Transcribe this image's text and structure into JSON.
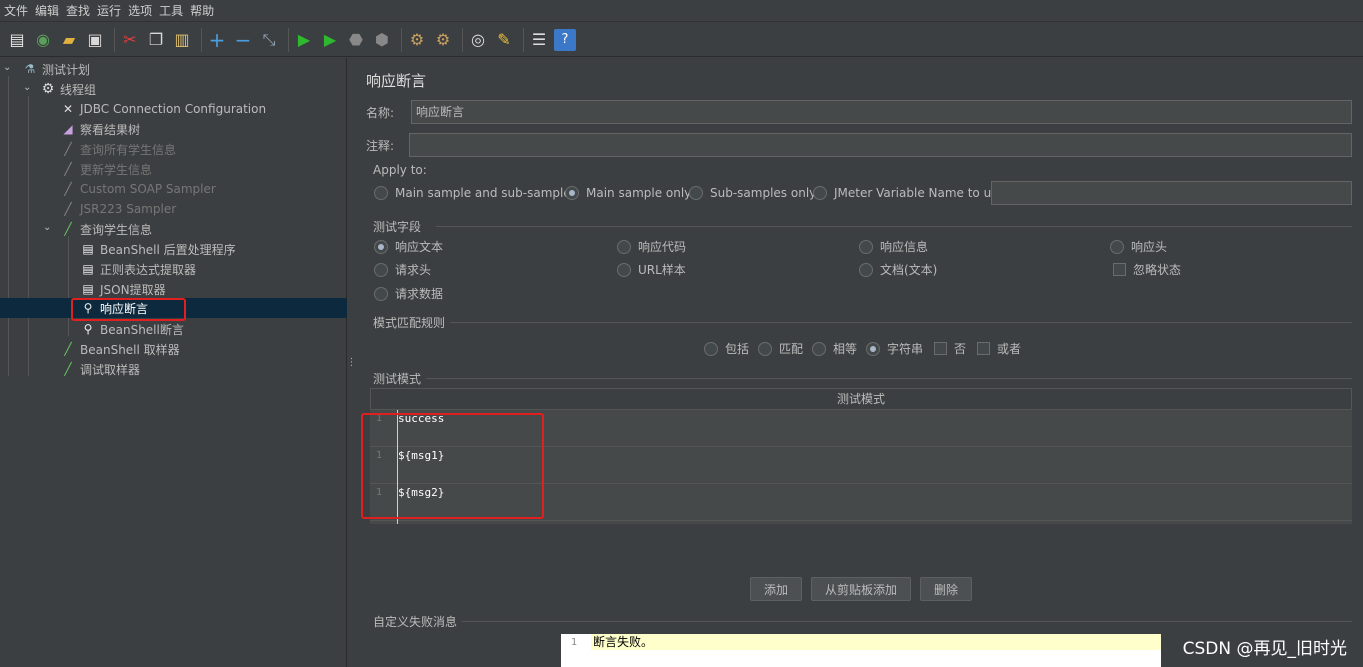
{
  "menu": [
    "文件",
    "编辑",
    "查找",
    "运行",
    "选项",
    "工具",
    "帮助"
  ],
  "toolbar_icons": [
    "new-icon",
    "templates-icon",
    "open-icon",
    "save-icon",
    "cut-icon",
    "copy-icon",
    "paste-icon",
    "expand-icon",
    "collapse-icon",
    "toggle-icon",
    "start-icon",
    "start-no-pause-icon",
    "stop-icon",
    "shutdown-icon",
    "clear-icon",
    "clear-all-icon",
    "search-icon",
    "reset-search-icon",
    "function-helper-icon",
    "help-icon"
  ],
  "tree": {
    "plan": "测试计划",
    "thread_group": "线程组",
    "items": [
      {
        "label": "JDBC Connection Configuration",
        "disabled": false
      },
      {
        "label": "察看结果树",
        "disabled": false
      },
      {
        "label": "查询所有学生信息",
        "disabled": true
      },
      {
        "label": "更新学生信息",
        "disabled": true
      },
      {
        "label": "Custom SOAP Sampler",
        "disabled": true
      },
      {
        "label": "JSR223 Sampler",
        "disabled": true
      },
      {
        "label": "查询学生信息",
        "disabled": false
      },
      {
        "label": "BeanShell 后置处理程序",
        "disabled": false
      },
      {
        "label": "正则表达式提取器",
        "disabled": false
      },
      {
        "label": "JSON提取器",
        "disabled": false
      },
      {
        "label": "响应断言",
        "disabled": false,
        "selected": true
      },
      {
        "label": "BeanShell断言",
        "disabled": false
      },
      {
        "label": "BeanShell 取样器",
        "disabled": false
      },
      {
        "label": "调试取样器",
        "disabled": false
      }
    ]
  },
  "panel": {
    "title": "响应断言",
    "name_label": "名称:",
    "name_value": "响应断言",
    "comment_label": "注释:",
    "comment_value": "",
    "apply_to": {
      "title": "Apply to:",
      "options": [
        "Main sample and sub-samples",
        "Main sample only",
        "Sub-samples only",
        "JMeter Variable Name to use"
      ],
      "selected": 1,
      "variable_value": ""
    },
    "test_field": {
      "title": "测试字段",
      "options": [
        "响应文本",
        "响应代码",
        "响应信息",
        "响应头",
        "请求头",
        "URL样本",
        "文档(文本)",
        "请求数据"
      ],
      "selected": 0,
      "ignore_status": "忽略状态"
    },
    "match_rules": {
      "title": "模式匹配规则",
      "radios": [
        "包括",
        "匹配",
        "相等",
        "字符串"
      ],
      "selected": 3,
      "checks": [
        "否",
        "或者"
      ]
    },
    "patterns": {
      "title": "测试模式",
      "header": "测试模式",
      "rows": [
        {
          "line": "1",
          "text": "success"
        },
        {
          "line": "1",
          "text": "${msg1}"
        },
        {
          "line": "1",
          "text": "${msg2}"
        }
      ]
    },
    "buttons": {
      "add": "添加",
      "add_clipboard": "从剪贴板添加",
      "delete": "删除"
    },
    "failure": {
      "title": "自定义失败消息",
      "line": "1",
      "text": "断言失败。"
    }
  },
  "watermark": "CSDN @再见_旧时光",
  "colors": {
    "highlight": "#e02020",
    "selected_row": "#0d293e",
    "background": "#3c3f41"
  }
}
